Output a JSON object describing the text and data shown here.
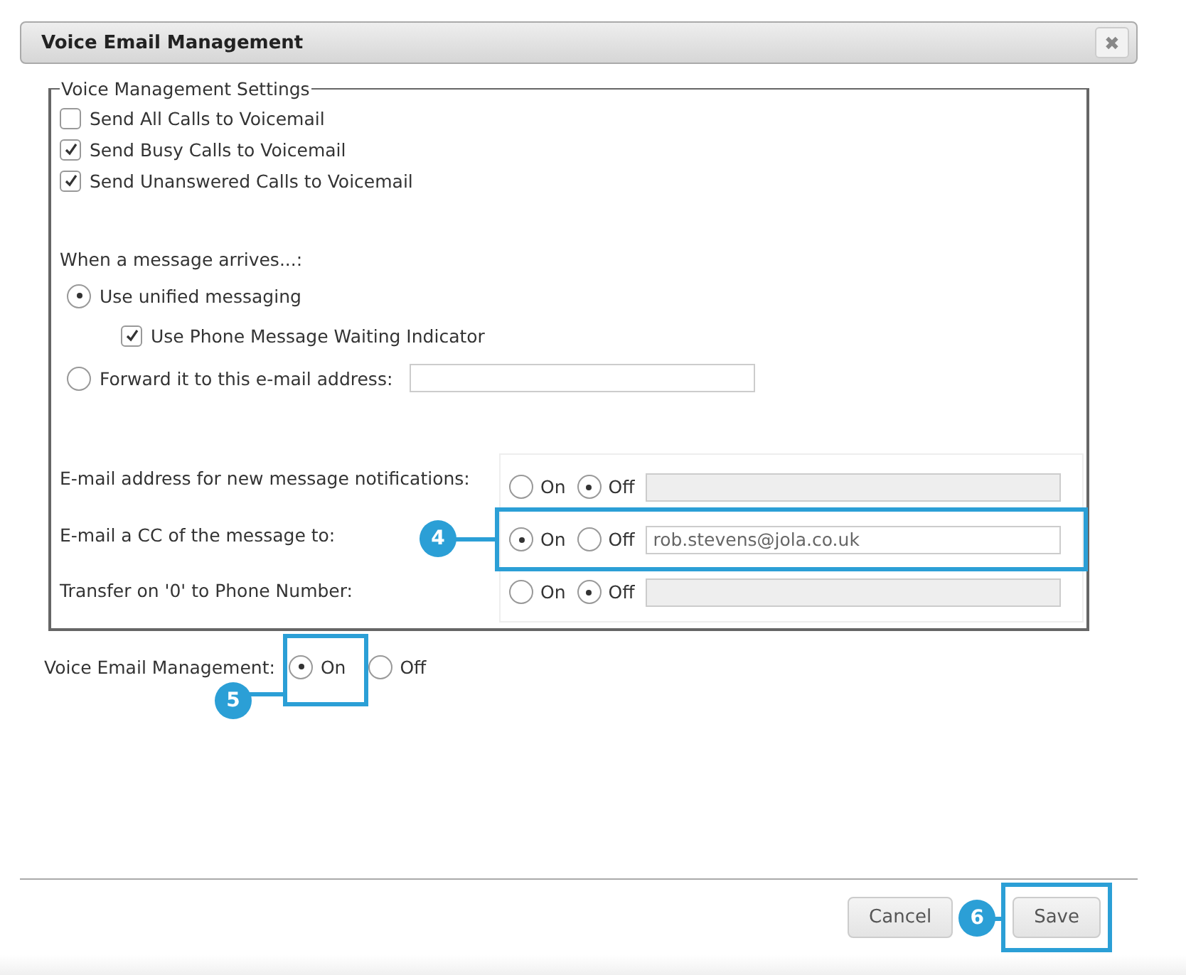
{
  "dialog": {
    "title": "Voice Email Management",
    "close_icon": "✖"
  },
  "settings": {
    "legend": "Voice Management Settings",
    "checkboxes": [
      {
        "label": "Send All Calls to Voicemail",
        "checked": false
      },
      {
        "label": "Send Busy Calls to Voicemail",
        "checked": true
      },
      {
        "label": "Send Unanswered Calls to Voicemail",
        "checked": true
      }
    ],
    "arrival_label": "When a message arrives...:",
    "arrival_options": [
      {
        "kind": "radio",
        "label": "Use unified messaging",
        "selected": true,
        "sub_checkbox": {
          "label": "Use Phone Message Waiting Indicator",
          "checked": true
        }
      },
      {
        "kind": "radio_with_field",
        "label": "Forward it to this e-mail address:",
        "selected": false
      }
    ],
    "rows": [
      {
        "label": "E-mail address for new message notifications:",
        "options": [
          {
            "label": "On",
            "selected": false
          },
          {
            "label": "Off",
            "selected": true
          }
        ],
        "disabled": true
      },
      {
        "label": "E-mail a CC of the message to:",
        "options": [
          {
            "label": "On",
            "selected": true
          },
          {
            "label": "Off",
            "selected": false
          }
        ],
        "value": "rob.stevens@jola.co.uk",
        "disabled": false,
        "callout": "4"
      },
      {
        "label": "Transfer on '0' to Phone Number:",
        "options": [
          {
            "label": "On",
            "selected": false
          },
          {
            "label": "Off",
            "selected": true
          }
        ],
        "disabled": true
      }
    ]
  },
  "master": {
    "label": "Voice Email Management:",
    "options": [
      {
        "label": "On",
        "selected": true
      },
      {
        "label": "Off",
        "selected": false
      }
    ],
    "callout": "5"
  },
  "buttons": [
    {
      "label": "Cancel"
    },
    {
      "label": "Save",
      "callout": "6"
    }
  ]
}
